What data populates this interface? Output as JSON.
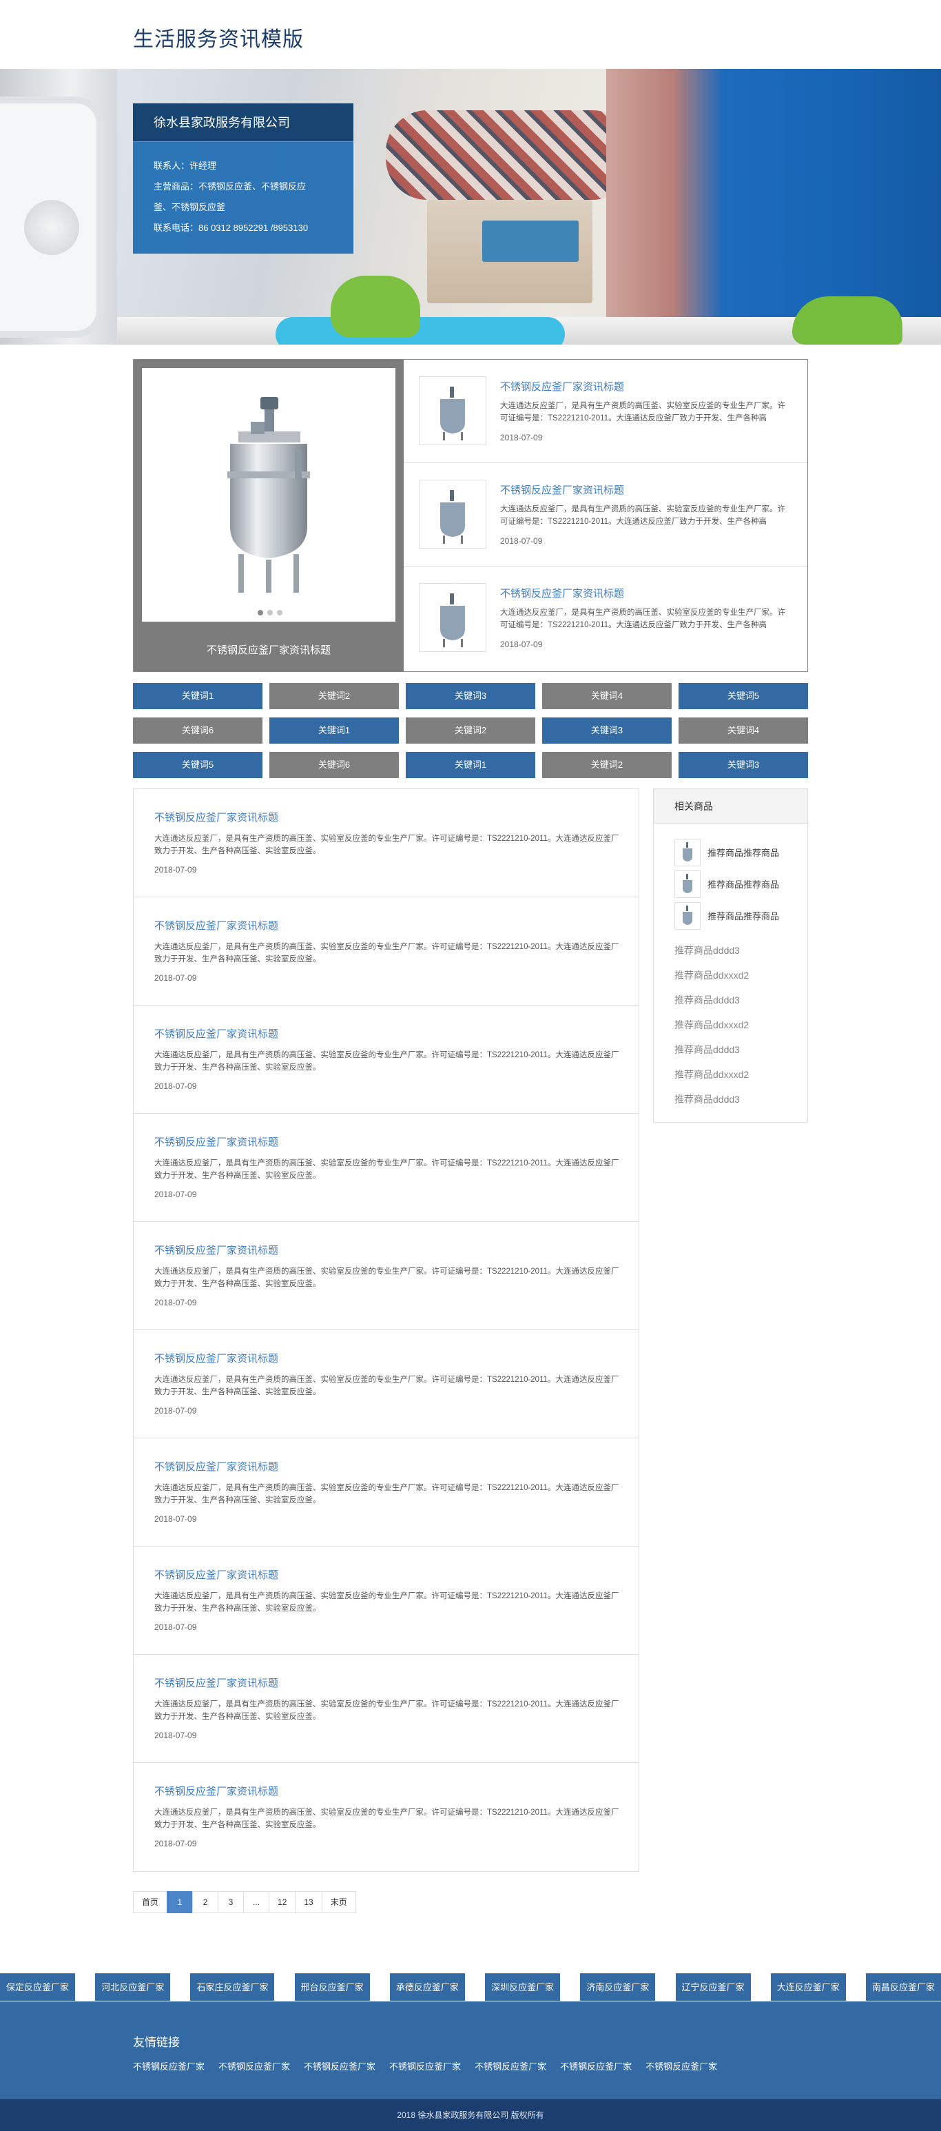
{
  "header": {
    "title": "生活服务资讯模版"
  },
  "company": {
    "name": "徐水县家政服务有限公司",
    "contact": "联系人：许经理",
    "products_line1": "主营商品：不锈钢反应釜、不锈钢反应",
    "products_line2": "釜、不锈钢反应釜",
    "phone": "联系电话：86 0312 8952291 /8953130"
  },
  "feature": {
    "slider_caption": "不锈钢反应釜厂家资讯标题",
    "items": [
      {
        "title": "不锈钢反应釜厂家资讯标题",
        "desc": "大连通达反应釜厂，是具有生产资质的高压釜、实验室反应釜的专业生产厂家。许可证编号是：TS2221210-2011。大连通达反应釜厂致力于开发、生产各种高",
        "date": "2018-07-09"
      },
      {
        "title": "不锈钢反应釜厂家资讯标题",
        "desc": "大连通达反应釜厂，是具有生产资质的高压釜、实验室反应釜的专业生产厂家。许可证编号是：TS2221210-2011。大连通达反应釜厂致力于开发、生产各种高",
        "date": "2018-07-09"
      },
      {
        "title": "不锈钢反应釜厂家资讯标题",
        "desc": "大连通达反应釜厂，是具有生产资质的高压釜、实验室反应釜的专业生产厂家。许可证编号是：TS2221210-2011。大连通达反应釜厂致力于开发、生产各种高",
        "date": "2018-07-09"
      }
    ]
  },
  "keywords": [
    {
      "label": "关键词1",
      "color": "#346aa4"
    },
    {
      "label": "关键词2",
      "color": "#7f7f7f"
    },
    {
      "label": "关键词3",
      "color": "#346aa4"
    },
    {
      "label": "关键词4",
      "color": "#7f7f7f"
    },
    {
      "label": "关键词5",
      "color": "#346aa4"
    },
    {
      "label": "关键词6",
      "color": "#7f7f7f"
    },
    {
      "label": "关键词1",
      "color": "#346aa4"
    },
    {
      "label": "关键词2",
      "color": "#7f7f7f"
    },
    {
      "label": "关键词3",
      "color": "#346aa4"
    },
    {
      "label": "关键词4",
      "color": "#7f7f7f"
    },
    {
      "label": "关键词5",
      "color": "#346aa4"
    },
    {
      "label": "关键词6",
      "color": "#7f7f7f"
    },
    {
      "label": "关键词1",
      "color": "#346aa4"
    },
    {
      "label": "关键词2",
      "color": "#7f7f7f"
    },
    {
      "label": "关键词3",
      "color": "#346aa4"
    }
  ],
  "news": [
    {
      "title": "不锈钢反应釜厂家资讯标题",
      "desc": "大连通达反应釜厂，是具有生产资质的高压釜、实验室反应釜的专业生产厂家。许可证编号是：TS2221210-2011。大连通达反应釜厂致力于开发、生产各种高压釜、实验室反应釜。",
      "date": "2018-07-09"
    },
    {
      "title": "不锈钢反应釜厂家资讯标题",
      "desc": "大连通达反应釜厂，是具有生产资质的高压釜、实验室反应釜的专业生产厂家。许可证编号是：TS2221210-2011。大连通达反应釜厂致力于开发、生产各种高压釜、实验室反应釜。",
      "date": "2018-07-09"
    },
    {
      "title": "不锈钢反应釜厂家资讯标题",
      "desc": "大连通达反应釜厂，是具有生产资质的高压釜、实验室反应釜的专业生产厂家。许可证编号是：TS2221210-2011。大连通达反应釜厂致力于开发、生产各种高压釜、实验室反应釜。",
      "date": "2018-07-09"
    },
    {
      "title": "不锈钢反应釜厂家资讯标题",
      "desc": "大连通达反应釜厂，是具有生产资质的高压釜、实验室反应釜的专业生产厂家。许可证编号是：TS2221210-2011。大连通达反应釜厂致力于开发、生产各种高压釜、实验室反应釜。",
      "date": "2018-07-09"
    },
    {
      "title": "不锈钢反应釜厂家资讯标题",
      "desc": "大连通达反应釜厂，是具有生产资质的高压釜、实验室反应釜的专业生产厂家。许可证编号是：TS2221210-2011。大连通达反应釜厂致力于开发、生产各种高压釜、实验室反应釜。",
      "date": "2018-07-09"
    },
    {
      "title": "不锈钢反应釜厂家资讯标题",
      "desc": "大连通达反应釜厂，是具有生产资质的高压釜、实验室反应釜的专业生产厂家。许可证编号是：TS2221210-2011。大连通达反应釜厂致力于开发、生产各种高压釜、实验室反应釜。",
      "date": "2018-07-09"
    },
    {
      "title": "不锈钢反应釜厂家资讯标题",
      "desc": "大连通达反应釜厂，是具有生产资质的高压釜、实验室反应釜的专业生产厂家。许可证编号是：TS2221210-2011。大连通达反应釜厂致力于开发、生产各种高压釜、实验室反应釜。",
      "date": "2018-07-09"
    },
    {
      "title": "不锈钢反应釜厂家资讯标题",
      "desc": "大连通达反应釜厂，是具有生产资质的高压釜、实验室反应釜的专业生产厂家。许可证编号是：TS2221210-2011。大连通达反应釜厂致力于开发、生产各种高压釜、实验室反应釜。",
      "date": "2018-07-09"
    },
    {
      "title": "不锈钢反应釜厂家资讯标题",
      "desc": "大连通达反应釜厂，是具有生产资质的高压釜、实验室反应釜的专业生产厂家。许可证编号是：TS2221210-2011。大连通达反应釜厂致力于开发、生产各种高压釜、实验室反应釜。",
      "date": "2018-07-09"
    },
    {
      "title": "不锈钢反应釜厂家资讯标题",
      "desc": "大连通达反应釜厂，是具有生产资质的高压釜、实验室反应釜的专业生产厂家。许可证编号是：TS2221210-2011。大连通达反应釜厂致力于开发、生产各种高压釜、实验室反应釜。",
      "date": "2018-07-09"
    }
  ],
  "sidebar": {
    "title": "相关商品",
    "image_items": [
      "推荐商品推荐商品",
      "推荐商品推荐商品",
      "推荐商品推荐商品"
    ],
    "text_items": [
      "推荐商品dddd3",
      "推荐商品ddxxxd2",
      "推荐商品dddd3",
      "推荐商品ddxxxd2",
      "推荐商品dddd3",
      "推荐商品ddxxxd2",
      "推荐商品dddd3"
    ]
  },
  "pagination": {
    "items": [
      "首页",
      "1",
      "2",
      "3",
      "...",
      "12",
      "13",
      "末页"
    ],
    "active": "1"
  },
  "cities": [
    "保定反应釜厂家",
    "河北反应釜厂家",
    "石家庄反应釜厂家",
    "邢台反应釜厂家",
    "承德反应釜厂家",
    "深圳反应釜厂家",
    "济南反应釜厂家",
    "辽宁反应釜厂家",
    "大连反应釜厂家",
    "南昌反应釜厂家"
  ],
  "friends": {
    "title": "友情链接",
    "links": [
      "不锈钢反应釜厂家",
      "不锈钢反应釜厂家",
      "不锈钢反应釜厂家",
      "不锈钢反应釜厂家",
      "不锈钢反应釜厂家",
      "不锈钢反应釜厂家",
      "不锈钢反应釜厂家"
    ]
  },
  "footer": {
    "copyright": "2018 徐水县家政服务有限公司 版权所有"
  },
  "colors": {
    "brand_blue": "#346aa4",
    "dark_navy": "#1c3e6e",
    "link_blue": "#3f7dc6",
    "gray_tile": "#7f7f7f"
  }
}
